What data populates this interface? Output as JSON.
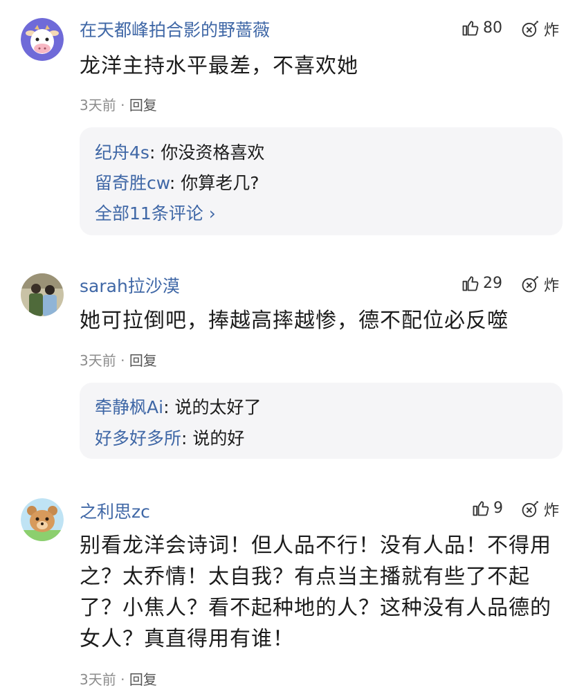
{
  "colors": {
    "username": "#3f67a6",
    "text": "#1c1c1c",
    "meta": "#8c8c8c",
    "reply_bg": "#f5f5f7"
  },
  "comments": [
    {
      "avatar_icon": "cartoon-cow-avatar",
      "username": "在天都峰拍合影的野蔷薇",
      "likes": "80",
      "blast_label": "炸",
      "text": "龙洋主持水平最差，不喜欢她",
      "time": "3天前",
      "separator": "·",
      "reply_label": "回复",
      "replies": [
        {
          "name": "纪舟4s",
          "colon": ": ",
          "text": "你没资格喜欢"
        },
        {
          "name": "留奇胜cw",
          "colon": ": ",
          "text": "你算老几?"
        }
      ],
      "more_label": "全部11条评论 ›"
    },
    {
      "avatar_icon": "photo-avatar",
      "username": "sarah拉沙漠",
      "likes": "29",
      "blast_label": "炸",
      "text": "她可拉倒吧，捧越高摔越惨，德不配位必反噬",
      "time": "3天前",
      "separator": "·",
      "reply_label": "回复",
      "replies": [
        {
          "name": "牵静枫Ai",
          "colon": ": ",
          "text": "说的太好了"
        },
        {
          "name": "好多好多所",
          "colon": ": ",
          "text": "说的好"
        }
      ]
    },
    {
      "avatar_icon": "cartoon-bear-avatar",
      "username": "之利思zc",
      "likes": "9",
      "blast_label": "炸",
      "text_lines": [
        "别看龙洋会诗词！但人品不行！没有人品！不得用",
        "之？太乔情！太自我？有点当主播就有些了不起",
        "了？小焦人？看不起种地的人？这种没有人品德的",
        "女人？真直得用有谁！"
      ],
      "time": "3天前",
      "separator": "·",
      "reply_label": "回复"
    }
  ]
}
